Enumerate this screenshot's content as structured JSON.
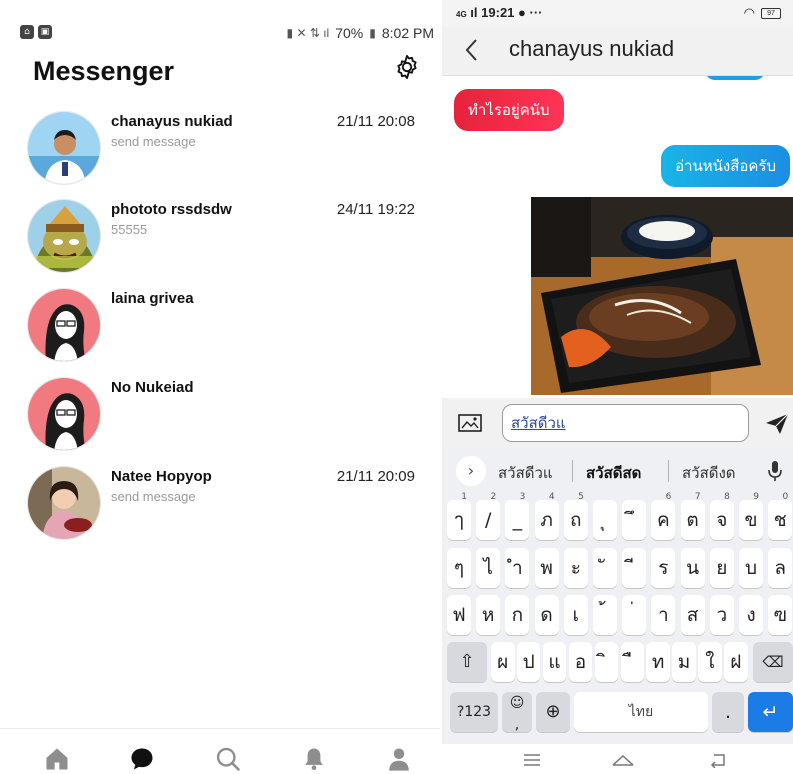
{
  "left": {
    "statusbar": {
      "battery": "70%",
      "time": "8:02 PM"
    },
    "title": "Messenger",
    "conversations": [
      {
        "name": "chanayus nukiad",
        "message": "send message",
        "time": "21/11 20:08"
      },
      {
        "name": "phototo rssdsdw",
        "message": "55555",
        "time": "24/11 19:22"
      },
      {
        "name": "laina grivea",
        "message": "",
        "time": ""
      },
      {
        "name": "No Nukeiad",
        "message": "",
        "time": ""
      },
      {
        "name": "Natee Hopyop",
        "message": "send message",
        "time": "21/11 20:09"
      }
    ],
    "nav_icons": [
      "home-icon",
      "chat-icon",
      "search-icon",
      "bell-icon",
      "profile-icon"
    ]
  },
  "right": {
    "statusbar": {
      "network": "4G",
      "time": "19:21",
      "battery": "97"
    },
    "chat_title": "chanayus nukiad",
    "messages": [
      {
        "direction": "incoming",
        "text": "ทำไรอยู่คนับ"
      },
      {
        "direction": "outgoing",
        "text": "อ่านหนังสือครับ"
      }
    ],
    "input_value": "สวัสดีวแ",
    "suggestions": [
      "สวัสดีวแ",
      "สวัสดีสด",
      "สวัสดีงด"
    ],
    "keyboard": {
      "row1": [
        "ๅ",
        "/",
        "_",
        "ภ",
        "ถ",
        "ุ",
        "ึ",
        "ค",
        "ต",
        "จ",
        "ข",
        "ช"
      ],
      "row1_hints": [
        "1",
        "2",
        "3",
        "4",
        "5",
        "",
        "",
        "6",
        "7",
        "8",
        "9",
        "0"
      ],
      "row2": [
        "ๆ",
        "ไ",
        "ำ",
        "พ",
        "ะ",
        "ั",
        "ี",
        "ร",
        "น",
        "ย",
        "บ",
        "ล"
      ],
      "row3": [
        "ฟ",
        "ห",
        "ก",
        "ด",
        "เ",
        "้",
        "่",
        "า",
        "ส",
        "ว",
        "ง",
        "ฃ"
      ],
      "row4": [
        "ผ",
        "ป",
        "แ",
        "อ",
        "ิ",
        "ื",
        "ท",
        "ม",
        "ใ",
        "ฝ"
      ],
      "sym_label": "?123",
      "emoji_label": "☺",
      "emoji_sub": ",",
      "space_label": "ไทย",
      "period_label": "."
    }
  }
}
